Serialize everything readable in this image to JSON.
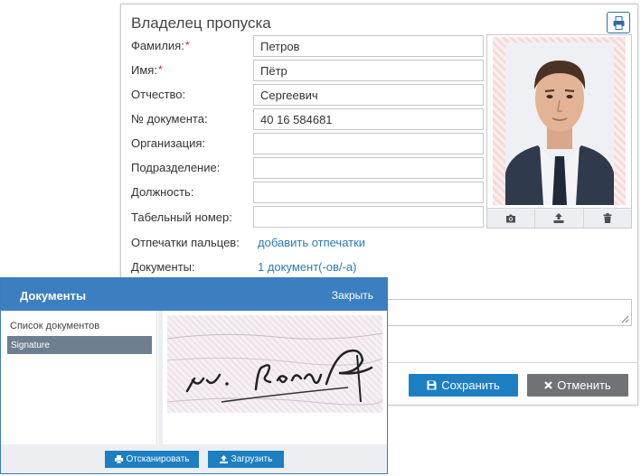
{
  "owner": {
    "title": "Владелец пропуска",
    "required_mark": "*",
    "fields": [
      {
        "label": "Фамилия:",
        "value": "Петров",
        "required": true
      },
      {
        "label": "Имя:",
        "value": "Пётр",
        "required": true
      },
      {
        "label": "Отчество:",
        "value": "Сергеевич",
        "required": false
      },
      {
        "label": "№ документа:",
        "value": "40 16 584681",
        "required": false
      },
      {
        "label": "Организация:",
        "value": "",
        "required": false
      },
      {
        "label": "Подразделение:",
        "value": "",
        "required": false
      },
      {
        "label": "Должность:",
        "value": "",
        "required": false
      },
      {
        "label": "Табельный номер:",
        "value": "",
        "required": false
      }
    ],
    "fingerprints_label": "Отпечатки пальцев:",
    "fingerprints_link": "добавить отпечатки",
    "documents_label": "Документы:",
    "documents_link": "1 документ(-ов/-а)"
  },
  "photo_tools": [
    "camera-icon",
    "upload-icon",
    "trash-icon"
  ],
  "actions": {
    "save_label": "Сохранить",
    "cancel_label": "Отменить"
  },
  "documents_dialog": {
    "title": "Документы",
    "close_label": "Закрыть",
    "list_label": "Список документов",
    "items": [
      "Signature"
    ],
    "scan_label": "Отсканировать",
    "upload_label": "Загрузить"
  },
  "colors": {
    "accent": "#1d7fc2",
    "dialog_header": "#3b7fc1",
    "cancel": "#6f7376",
    "link": "#2a7ab8",
    "required": "#e02020"
  }
}
